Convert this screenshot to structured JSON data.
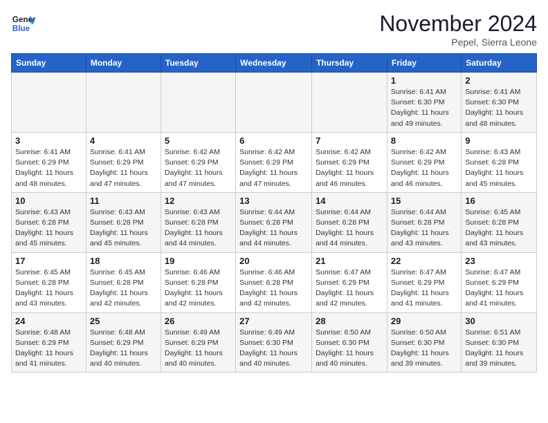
{
  "header": {
    "logo_line1": "General",
    "logo_line2": "Blue",
    "month_title": "November 2024",
    "location": "Pepel, Sierra Leone"
  },
  "days_of_week": [
    "Sunday",
    "Monday",
    "Tuesday",
    "Wednesday",
    "Thursday",
    "Friday",
    "Saturday"
  ],
  "weeks": [
    [
      {
        "day": "",
        "detail": ""
      },
      {
        "day": "",
        "detail": ""
      },
      {
        "day": "",
        "detail": ""
      },
      {
        "day": "",
        "detail": ""
      },
      {
        "day": "",
        "detail": ""
      },
      {
        "day": "1",
        "detail": "Sunrise: 6:41 AM\nSunset: 6:30 PM\nDaylight: 11 hours\nand 49 minutes."
      },
      {
        "day": "2",
        "detail": "Sunrise: 6:41 AM\nSunset: 6:30 PM\nDaylight: 11 hours\nand 48 minutes."
      }
    ],
    [
      {
        "day": "3",
        "detail": "Sunrise: 6:41 AM\nSunset: 6:29 PM\nDaylight: 11 hours\nand 48 minutes."
      },
      {
        "day": "4",
        "detail": "Sunrise: 6:41 AM\nSunset: 6:29 PM\nDaylight: 11 hours\nand 47 minutes."
      },
      {
        "day": "5",
        "detail": "Sunrise: 6:42 AM\nSunset: 6:29 PM\nDaylight: 11 hours\nand 47 minutes."
      },
      {
        "day": "6",
        "detail": "Sunrise: 6:42 AM\nSunset: 6:29 PM\nDaylight: 11 hours\nand 47 minutes."
      },
      {
        "day": "7",
        "detail": "Sunrise: 6:42 AM\nSunset: 6:29 PM\nDaylight: 11 hours\nand 46 minutes."
      },
      {
        "day": "8",
        "detail": "Sunrise: 6:42 AM\nSunset: 6:29 PM\nDaylight: 11 hours\nand 46 minutes."
      },
      {
        "day": "9",
        "detail": "Sunrise: 6:43 AM\nSunset: 6:28 PM\nDaylight: 11 hours\nand 45 minutes."
      }
    ],
    [
      {
        "day": "10",
        "detail": "Sunrise: 6:43 AM\nSunset: 6:28 PM\nDaylight: 11 hours\nand 45 minutes."
      },
      {
        "day": "11",
        "detail": "Sunrise: 6:43 AM\nSunset: 6:28 PM\nDaylight: 11 hours\nand 45 minutes."
      },
      {
        "day": "12",
        "detail": "Sunrise: 6:43 AM\nSunset: 6:28 PM\nDaylight: 11 hours\nand 44 minutes."
      },
      {
        "day": "13",
        "detail": "Sunrise: 6:44 AM\nSunset: 6:28 PM\nDaylight: 11 hours\nand 44 minutes."
      },
      {
        "day": "14",
        "detail": "Sunrise: 6:44 AM\nSunset: 6:28 PM\nDaylight: 11 hours\nand 44 minutes."
      },
      {
        "day": "15",
        "detail": "Sunrise: 6:44 AM\nSunset: 6:28 PM\nDaylight: 11 hours\nand 43 minutes."
      },
      {
        "day": "16",
        "detail": "Sunrise: 6:45 AM\nSunset: 6:28 PM\nDaylight: 11 hours\nand 43 minutes."
      }
    ],
    [
      {
        "day": "17",
        "detail": "Sunrise: 6:45 AM\nSunset: 6:28 PM\nDaylight: 11 hours\nand 43 minutes."
      },
      {
        "day": "18",
        "detail": "Sunrise: 6:45 AM\nSunset: 6:28 PM\nDaylight: 11 hours\nand 42 minutes."
      },
      {
        "day": "19",
        "detail": "Sunrise: 6:46 AM\nSunset: 6:28 PM\nDaylight: 11 hours\nand 42 minutes."
      },
      {
        "day": "20",
        "detail": "Sunrise: 6:46 AM\nSunset: 6:28 PM\nDaylight: 11 hours\nand 42 minutes."
      },
      {
        "day": "21",
        "detail": "Sunrise: 6:47 AM\nSunset: 6:29 PM\nDaylight: 11 hours\nand 42 minutes."
      },
      {
        "day": "22",
        "detail": "Sunrise: 6:47 AM\nSunset: 6:29 PM\nDaylight: 11 hours\nand 41 minutes."
      },
      {
        "day": "23",
        "detail": "Sunrise: 6:47 AM\nSunset: 6:29 PM\nDaylight: 11 hours\nand 41 minutes."
      }
    ],
    [
      {
        "day": "24",
        "detail": "Sunrise: 6:48 AM\nSunset: 6:29 PM\nDaylight: 11 hours\nand 41 minutes."
      },
      {
        "day": "25",
        "detail": "Sunrise: 6:48 AM\nSunset: 6:29 PM\nDaylight: 11 hours\nand 40 minutes."
      },
      {
        "day": "26",
        "detail": "Sunrise: 6:49 AM\nSunset: 6:29 PM\nDaylight: 11 hours\nand 40 minutes."
      },
      {
        "day": "27",
        "detail": "Sunrise: 6:49 AM\nSunset: 6:30 PM\nDaylight: 11 hours\nand 40 minutes."
      },
      {
        "day": "28",
        "detail": "Sunrise: 6:50 AM\nSunset: 6:30 PM\nDaylight: 11 hours\nand 40 minutes."
      },
      {
        "day": "29",
        "detail": "Sunrise: 6:50 AM\nSunset: 6:30 PM\nDaylight: 11 hours\nand 39 minutes."
      },
      {
        "day": "30",
        "detail": "Sunrise: 6:51 AM\nSunset: 6:30 PM\nDaylight: 11 hours\nand 39 minutes."
      }
    ]
  ]
}
